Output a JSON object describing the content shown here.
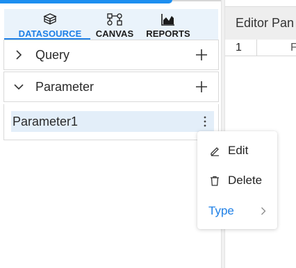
{
  "tabs": [
    {
      "label": "DATASOURCE",
      "icon": "database-icon",
      "active": true
    },
    {
      "label": "CANVAS",
      "icon": "canvas-flow-icon",
      "active": false
    },
    {
      "label": "REPORTS",
      "icon": "bar-chart-icon",
      "active": false
    }
  ],
  "sections": {
    "query": {
      "label": "Query",
      "state": "collapsed"
    },
    "parameter": {
      "label": "Parameter",
      "state": "expanded"
    }
  },
  "parameter_items": [
    {
      "name": "Parameter1"
    }
  ],
  "editor": {
    "title": "Editor Pan",
    "row_number": "1",
    "cell_fragment": "F"
  },
  "context_menu": {
    "items": [
      {
        "label": "Edit",
        "icon": "pencil-icon"
      },
      {
        "label": "Delete",
        "icon": "trash-icon"
      },
      {
        "label": "Type",
        "icon": "chevron-right-icon"
      }
    ]
  },
  "colors": {
    "accent": "#1d7fe6",
    "tab_bar_bg": "#eaf3fb",
    "selected_item_bg": "#e3eef9"
  }
}
